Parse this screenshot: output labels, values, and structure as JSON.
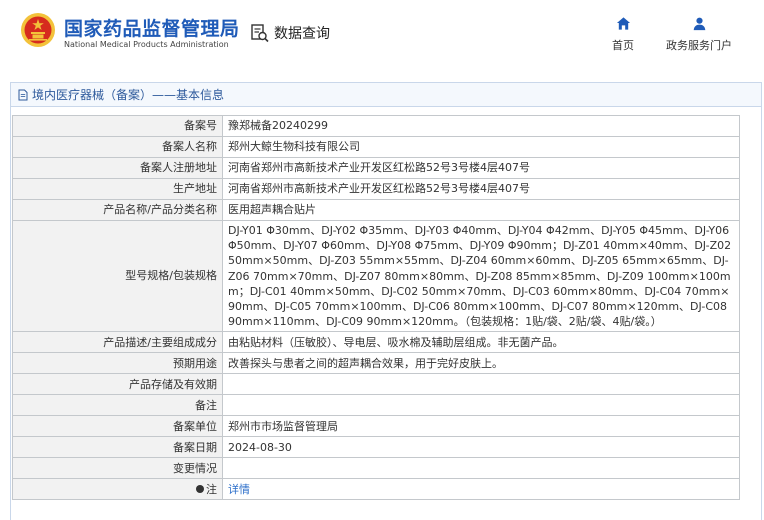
{
  "header": {
    "site_name_cn": "国家药品监督管理局",
    "site_name_en": "National Medical Products Administration",
    "data_query_label": "数据查询",
    "nav": {
      "home_label": "首页",
      "service_label": "政务服务门户"
    }
  },
  "panel": {
    "breadcrumb": "境内医疗器械（备案）——基本信息"
  },
  "record": {
    "rows": [
      {
        "label": "备案号",
        "value": "豫郑械备20240299"
      },
      {
        "label": "备案人名称",
        "value": "郑州大鲸生物科技有限公司"
      },
      {
        "label": "备案人注册地址",
        "value": "河南省郑州市高新技术产业开发区红松路52号3号楼4层407号"
      },
      {
        "label": "生产地址",
        "value": "河南省郑州市高新技术产业开发区红松路52号3号楼4层407号"
      },
      {
        "label": "产品名称/产品分类名称",
        "value": "医用超声耦合贴片"
      },
      {
        "label": "型号规格/包装规格",
        "value": "DJ-Y01 Φ30mm、DJ-Y02 Φ35mm、DJ-Y03 Φ40mm、DJ-Y04 Φ42mm、DJ-Y05 Φ45mm、DJ-Y06 Φ50mm、DJ-Y07 Φ60mm、DJ-Y08 Φ75mm、DJ-Y09 Φ90mm；DJ-Z01 40mm×40mm、DJ-Z02 50mm×50mm、DJ-Z03 55mm×55mm、DJ-Z04 60mm×60mm、DJ-Z05 65mm×65mm、DJ-Z06 70mm×70mm、DJ-Z07 80mm×80mm、DJ-Z08 85mm×85mm、DJ-Z09 100mm×100mm；DJ-C01 40mm×50mm、DJ-C02 50mm×70mm、DJ-C03 60mm×80mm、DJ-C04 70mm×90mm、DJ-C05 70mm×100mm、DJ-C06 80mm×100mm、DJ-C07 80mm×120mm、DJ-C08 90mm×110mm、DJ-C09 90mm×120mm。（包装规格：1贴/袋、2贴/袋、4贴/袋。）"
      },
      {
        "label": "产品描述/主要组成成分",
        "value": "由粘贴材料（压敏胶）、导电层、吸水棉及辅助层组成。非无菌产品。"
      },
      {
        "label": "预期用途",
        "value": "改善探头与患者之间的超声耦合效果，用于完好皮肤上。"
      },
      {
        "label": "产品存储及有效期",
        "value": ""
      },
      {
        "label": "备注",
        "value": ""
      },
      {
        "label": "备案单位",
        "value": "郑州市市场监督管理局"
      },
      {
        "label": "备案日期",
        "value": "2024-08-30"
      },
      {
        "label": "变更情况",
        "value": ""
      }
    ],
    "note_label": "注",
    "note_link": "详情"
  },
  "colors": {
    "brand_blue": "#1f5bb8",
    "emblem_red": "#d62b1e",
    "emblem_gold": "#f3c23a",
    "link_blue": "#2a6dc9"
  },
  "icons": {
    "logo": "national-emblem-icon",
    "data_query": "document-search-icon",
    "home": "home-icon",
    "service": "user-icon",
    "breadcrumb": "document-icon",
    "note": "dot-icon"
  }
}
